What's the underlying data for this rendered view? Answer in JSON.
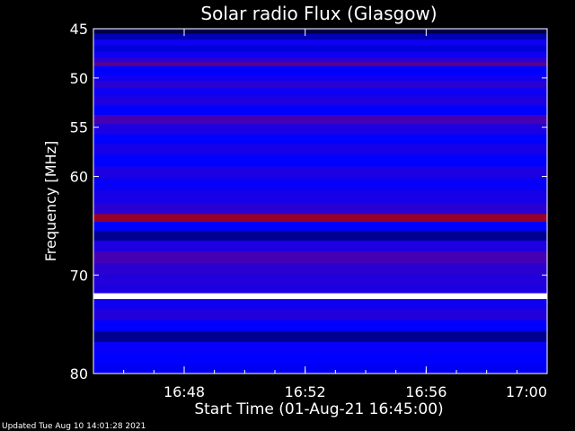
{
  "chart_data": {
    "type": "heatmap",
    "title": "Solar radio Flux (Glasgow)",
    "xlabel": "Start Time (01-Aug-21 16:45:00)",
    "ylabel": "Frequency [MHz]",
    "footer": "Updated Tue Aug 10 14:01:28 2021",
    "x_range": [
      "16:45",
      "17:00"
    ],
    "y_range": [
      45,
      80
    ],
    "y_ticks": [
      "45",
      "50",
      "55",
      "60",
      "70",
      "80"
    ],
    "x_ticks": [
      "16:48",
      "16:52",
      "16:56",
      "17:00"
    ],
    "colormap": [
      "#000020",
      "#0000ff",
      "#8b0000",
      "#ff0000",
      "#ffff00",
      "#ffffff"
    ],
    "bands": [
      {
        "freq": 45.2,
        "level": 0.05
      },
      {
        "freq": 45.8,
        "level": 0.2
      },
      {
        "freq": 46.4,
        "level": 0.35
      },
      {
        "freq": 47.0,
        "level": 0.25
      },
      {
        "freq": 47.6,
        "level": 0.35
      },
      {
        "freq": 48.2,
        "level": 0.45
      },
      {
        "freq": 48.6,
        "level": 0.6
      },
      {
        "freq": 49.0,
        "level": 0.3
      },
      {
        "freq": 49.4,
        "level": 0.3
      },
      {
        "freq": 50.0,
        "level": 0.35
      },
      {
        "freq": 50.6,
        "level": 0.45
      },
      {
        "freq": 51.4,
        "level": 0.35
      },
      {
        "freq": 52.3,
        "level": 0.4
      },
      {
        "freq": 53.3,
        "level": 0.3
      },
      {
        "freq": 54.2,
        "level": 0.55
      },
      {
        "freq": 55.2,
        "level": 0.4
      },
      {
        "freq": 56.2,
        "level": 0.3
      },
      {
        "freq": 57.2,
        "level": 0.38
      },
      {
        "freq": 58.4,
        "level": 0.3
      },
      {
        "freq": 59.6,
        "level": 0.4
      },
      {
        "freq": 60.8,
        "level": 0.32
      },
      {
        "freq": 62.0,
        "level": 0.38
      },
      {
        "freq": 63.4,
        "level": 0.45
      },
      {
        "freq": 64.2,
        "level": 0.72
      },
      {
        "freq": 65.0,
        "level": 0.3
      },
      {
        "freq": 66.0,
        "level": 0.15
      },
      {
        "freq": 67.0,
        "level": 0.4
      },
      {
        "freq": 68.2,
        "level": 0.55
      },
      {
        "freq": 69.4,
        "level": 0.45
      },
      {
        "freq": 70.6,
        "level": 0.42
      },
      {
        "freq": 71.6,
        "level": 0.4
      },
      {
        "freq": 72.1,
        "level": 1.0
      },
      {
        "freq": 72.8,
        "level": 0.35
      },
      {
        "freq": 74.0,
        "level": 0.42
      },
      {
        "freq": 75.2,
        "level": 0.3
      },
      {
        "freq": 76.2,
        "level": 0.15
      },
      {
        "freq": 77.4,
        "level": 0.32
      },
      {
        "freq": 78.6,
        "level": 0.3
      },
      {
        "freq": 79.6,
        "level": 0.28
      }
    ]
  }
}
